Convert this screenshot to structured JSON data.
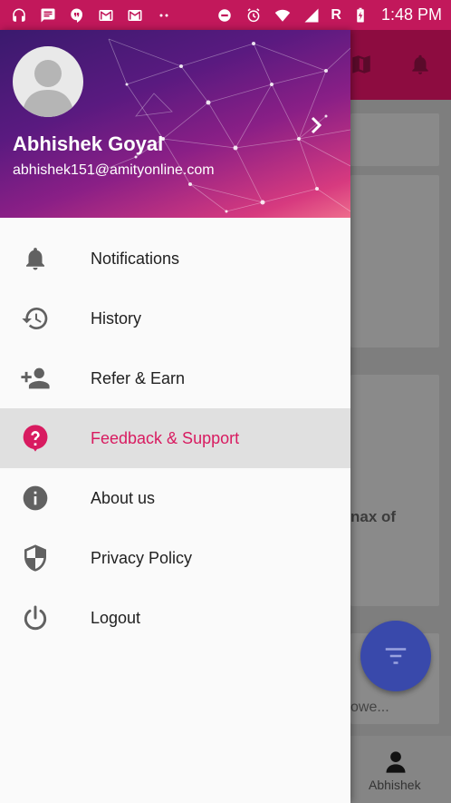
{
  "status_bar": {
    "time": "1:48 PM",
    "network_letter": "R",
    "left_icons": [
      "headset-icon",
      "message-icon",
      "hangouts-icon",
      "gmail-icon",
      "gmail-icon",
      "more-dots-icon"
    ],
    "right_icons": [
      "do-not-disturb-icon",
      "alarm-icon",
      "wifi-icon",
      "signal-icon",
      "battery-charging-icon"
    ]
  },
  "drawer": {
    "header": {
      "user_name": "Abhishek Goyal",
      "user_email": "abhishek151@amityonline.com"
    },
    "items": [
      {
        "label": "Notifications",
        "icon": "bell-icon",
        "active": false
      },
      {
        "label": "History",
        "icon": "history-icon",
        "active": false
      },
      {
        "label": "Refer & Earn",
        "icon": "add-person-icon",
        "active": false
      },
      {
        "label": "Feedback & Support",
        "icon": "help-bubble-icon",
        "active": true
      },
      {
        "label": "About us",
        "icon": "info-icon",
        "active": false
      },
      {
        "label": "Privacy Policy",
        "icon": "shield-icon",
        "active": false
      },
      {
        "label": "Logout",
        "icon": "power-icon",
        "active": false
      }
    ]
  },
  "background": {
    "partial_text_1": "nax of",
    "partial_text_2": "owe...",
    "bottom_nav_label": "Abhishek"
  },
  "colors": {
    "status_bar": "#c2185b",
    "accent": "#d81b60",
    "fab": "#3949ab"
  }
}
